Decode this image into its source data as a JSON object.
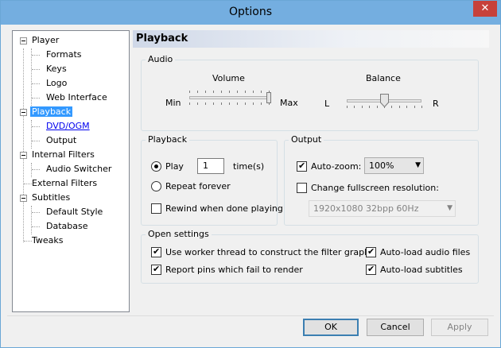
{
  "window": {
    "title": "Options",
    "close_glyph": "✕"
  },
  "tree": {
    "items": [
      {
        "label": "Player"
      },
      {
        "label": "Formats"
      },
      {
        "label": "Keys"
      },
      {
        "label": "Logo"
      },
      {
        "label": "Web Interface"
      },
      {
        "label": "Playback"
      },
      {
        "label": "DVD/OGM"
      },
      {
        "label": "Output"
      },
      {
        "label": "Internal Filters"
      },
      {
        "label": "Audio Switcher"
      },
      {
        "label": "External Filters"
      },
      {
        "label": "Subtitles"
      },
      {
        "label": "Default Style"
      },
      {
        "label": "Database"
      },
      {
        "label": "Tweaks"
      }
    ],
    "selected": "Playback"
  },
  "panel": {
    "title": "Playback",
    "audio": {
      "title": "Audio",
      "volume_label": "Volume",
      "volume_min": "Min",
      "volume_max": "Max",
      "volume_level": 1.0,
      "balance_label": "Balance",
      "balance_left": "L",
      "balance_right": "R",
      "balance_level": 0.5
    },
    "playback": {
      "title": "Playback",
      "play_label": "Play",
      "play_times_value": "1",
      "times_label": "time(s)",
      "repeat_label": "Repeat forever",
      "rewind_label": "Rewind when done playing",
      "play_selected": true,
      "rewind_checked": false
    },
    "output": {
      "title": "Output",
      "autozoom_label": "Auto-zoom:",
      "autozoom_checked": true,
      "autozoom_value": "100%",
      "fullscreen_label": "Change fullscreen resolution:",
      "fullscreen_checked": false,
      "resolution_value": "1920x1080 32bpp 60Hz"
    },
    "open_settings": {
      "title": "Open settings",
      "worker_thread_label": "Use worker thread to construct the filter graph",
      "report_pins_label": "Report pins which fail to render",
      "autoload_audio_label": "Auto-load audio files",
      "autoload_subs_label": "Auto-load subtitles"
    }
  },
  "buttons": {
    "ok": "OK",
    "cancel": "Cancel",
    "apply": "Apply"
  },
  "colors": {
    "title_bar": "#74aee0",
    "selection": "#3399ff",
    "close": "#c7413b"
  }
}
